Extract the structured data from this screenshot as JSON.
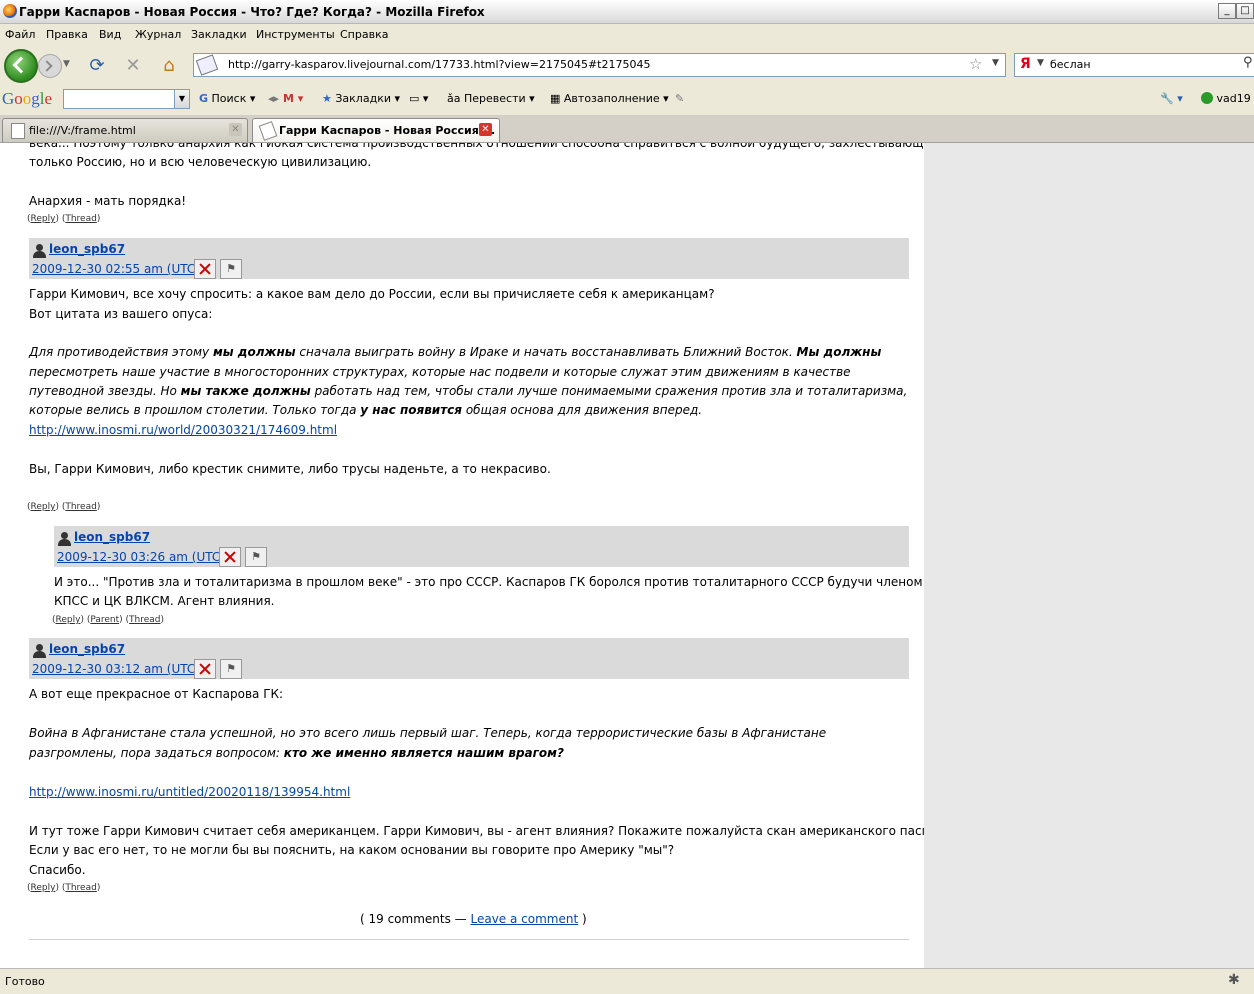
{
  "window": {
    "title": "Гарри Каспаров - Новая Россия - Что? Где? Когда? - Mozilla Firefox"
  },
  "menu": [
    "Файл",
    "Правка",
    "Вид",
    "Журнал",
    "Закладки",
    "Инструменты",
    "Справка"
  ],
  "nav": {
    "url": "http://garry-kasparov.livejournal.com/17733.html?view=2175045#t2175045",
    "search_engine": "Я",
    "search_value": "беслан"
  },
  "google_toolbar": {
    "logo": "Google",
    "search_label": "Поиск",
    "bookmarks_label": "Закладки",
    "translate_label": "Перевести",
    "autofill_label": "Автозаполнение",
    "user": "vad19"
  },
  "tabs": [
    {
      "label": "file:///V:/frame.html",
      "active": false
    },
    {
      "label": "Гарри Каспаров - Новая Россия ...",
      "active": true
    }
  ],
  "comments": {
    "top_text_1": "века... Поэтому только анархия как гибкая система производственных отношений способна справиться с волной будущего, захлестывающей не",
    "top_text_2": "только Россию, но и всю человеческую цивилизацию.",
    "top_text_3": "Анархия - мать порядка!",
    "reply": "Reply",
    "thread": "Thread",
    "parent": "Parent",
    "c1": {
      "user": "leon_spb67",
      "date": "2009-12-30 02:55 am (UTC)",
      "line1": "Гарри Кимович, все хочу спросить: а какое вам дело до России, если вы причисляете себя к американцам?",
      "line2": "Вот цитата из вашего опуса:",
      "q1a": "Для противодействия этому ",
      "q1b": "мы должны",
      "q1c": " сначала выиграть войну в Ираке и начать восстанавливать Ближний Восток. ",
      "q1d": "Мы должны",
      "q2": "пересмотреть наше участие в многосторонних структурах, которые нас подвели и которые служат этим движениям в качестве",
      "q3a": "путеводной звезды. Но ",
      "q3b": "мы также должны",
      "q3c": " работать над тем, чтобы стали лучше понимаемыми сражения против зла и тоталитаризма,",
      "q4a": "которые велись в прошлом столетии. Только тогда ",
      "q4b": "у нас появится",
      "q4c": " общая основа для движения вперед.",
      "link": "http://www.inosmi.ru/world/20030321/174609.html",
      "line3": "Вы, Гарри Кимович, либо крестик снимите, либо трусы наденьте, а то некрасиво."
    },
    "c2": {
      "user": "leon_spb67",
      "date": "2009-12-30 03:26 am (UTC)",
      "line1": "И это... \"Против зла и тоталитаризма в прошлом веке\" - это про СССР. Каспаров ГК боролся против тоталитарного СССР будучи членом",
      "line2": "КПСС и ЦК ВЛКСМ. Агент влияния."
    },
    "c3": {
      "user": "leon_spb67",
      "date": "2009-12-30 03:12 am (UTC)",
      "line1": "А вот еще прекрасное от Каспарова ГК:",
      "q1": "Война в Афганистане стала успешной, но это всего лишь первый шаг. Теперь, когда террористические базы в Афганистане",
      "q2a": "разгромлены, пора задаться вопросом: ",
      "q2b": "кто же именно является нашим врагом?",
      "link": "http://www.inosmi.ru/untitled/20020118/139954.html",
      "line2": "И тут тоже Гарри Кимович считает себя американцем. Гарри Кимович, вы - агент влияния? Покажите пожалуйста скан американского паспорта.",
      "line3": "Если у вас его нет, то не могли бы вы пояснить, на каком основании вы говорите про Америку \"мы\"?",
      "line4": "Спасибо."
    },
    "footer_count": "( 19 comments — ",
    "footer_link": "Leave a comment",
    "footer_end": " )"
  },
  "status": "Готово"
}
